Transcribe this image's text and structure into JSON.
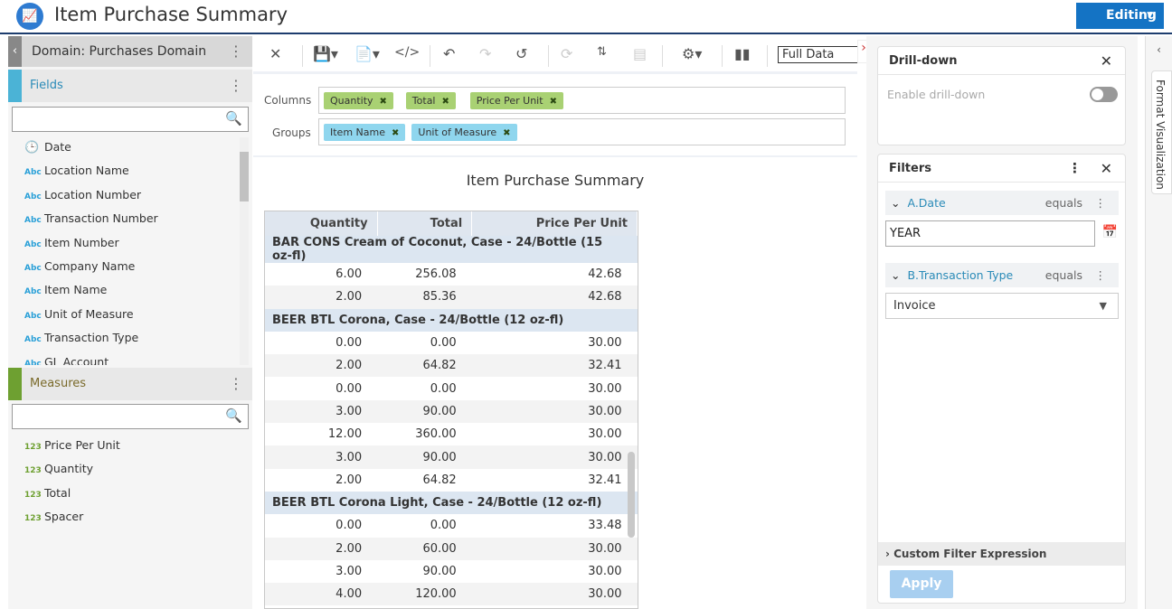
{
  "header": {
    "title": "Item Purchase Summary",
    "mode_button": "Editing"
  },
  "left": {
    "domain": "Domain: Purchases Domain",
    "fields_label": "Fields",
    "fields_search_placeholder": "",
    "fields": [
      {
        "icon": "clock-icon",
        "type": "date",
        "label": "Date"
      },
      {
        "icon": "abc-icon",
        "type": "text",
        "label": "Location Name"
      },
      {
        "icon": "abc-icon",
        "type": "text",
        "label": "Location Number"
      },
      {
        "icon": "abc-icon",
        "type": "text",
        "label": "Transaction Number"
      },
      {
        "icon": "abc-icon",
        "type": "text",
        "label": "Item Number"
      },
      {
        "icon": "abc-icon",
        "type": "text",
        "label": "Company Name"
      },
      {
        "icon": "abc-icon",
        "type": "text",
        "label": "Item Name"
      },
      {
        "icon": "abc-icon",
        "type": "text",
        "label": "Unit of Measure"
      },
      {
        "icon": "abc-icon",
        "type": "text",
        "label": "Transaction Type"
      },
      {
        "icon": "abc-icon",
        "type": "text",
        "label": "GL Account"
      }
    ],
    "measures_label": "Measures",
    "measures": [
      {
        "icon": "123-icon",
        "label": "Price Per Unit"
      },
      {
        "icon": "123-icon",
        "label": "Quantity"
      },
      {
        "icon": "123-icon",
        "label": "Total"
      },
      {
        "icon": "123-icon",
        "label": "Spacer"
      }
    ],
    "abc_glyph": "Abc",
    "num_glyph": "123"
  },
  "toolbar": {
    "data_mode": "Full Data"
  },
  "builder": {
    "columns_label": "Columns",
    "columns": [
      "Quantity",
      "Total",
      "Price Per Unit"
    ],
    "groups_label": "Groups",
    "groups": [
      "Item Name",
      "Unit of Measure"
    ]
  },
  "report": {
    "title": "Item Purchase Summary",
    "headers": [
      "Quantity",
      "Total",
      "Price Per Unit"
    ],
    "groups": [
      {
        "name": "BAR CONS Cream of Coconut, Case - 24/Bottle (15 oz-fl)",
        "rows": [
          [
            "6.00",
            "256.08",
            "42.68"
          ],
          [
            "2.00",
            "85.36",
            "42.68"
          ]
        ]
      },
      {
        "name": "BEER BTL Corona, Case - 24/Bottle (12 oz-fl)",
        "rows": [
          [
            "0.00",
            "0.00",
            "30.00"
          ],
          [
            "2.00",
            "64.82",
            "32.41"
          ],
          [
            "0.00",
            "0.00",
            "30.00"
          ],
          [
            "3.00",
            "90.00",
            "30.00"
          ],
          [
            "12.00",
            "360.00",
            "30.00"
          ],
          [
            "3.00",
            "90.00",
            "30.00"
          ],
          [
            "2.00",
            "64.82",
            "32.41"
          ]
        ]
      },
      {
        "name": "BEER BTL Corona Light, Case - 24/Bottle (12 oz-fl)",
        "rows": [
          [
            "0.00",
            "0.00",
            "33.48"
          ],
          [
            "2.00",
            "60.00",
            "30.00"
          ],
          [
            "3.00",
            "90.00",
            "30.00"
          ],
          [
            "4.00",
            "120.00",
            "30.00"
          ]
        ]
      }
    ]
  },
  "right": {
    "drilldown_title": "Drill-down",
    "drilldown_toggle_label": "Enable drill-down",
    "drilldown_enabled": false,
    "filters_title": "Filters",
    "filters": [
      {
        "name": "A.Date",
        "operator": "equals",
        "value": "YEAR"
      },
      {
        "name": "B.Transaction Type",
        "operator": "equals",
        "value": "Invoice"
      }
    ],
    "custom_expr": "Custom Filter Expression",
    "apply": "Apply",
    "format_tab": "Format Visualization"
  },
  "colors": {
    "accent": "#1473c4",
    "fields_bar": "#4bb3d6",
    "measures_bar": "#6ea031",
    "column_chip": "#a9d173",
    "group_chip": "#8fd6ee"
  }
}
